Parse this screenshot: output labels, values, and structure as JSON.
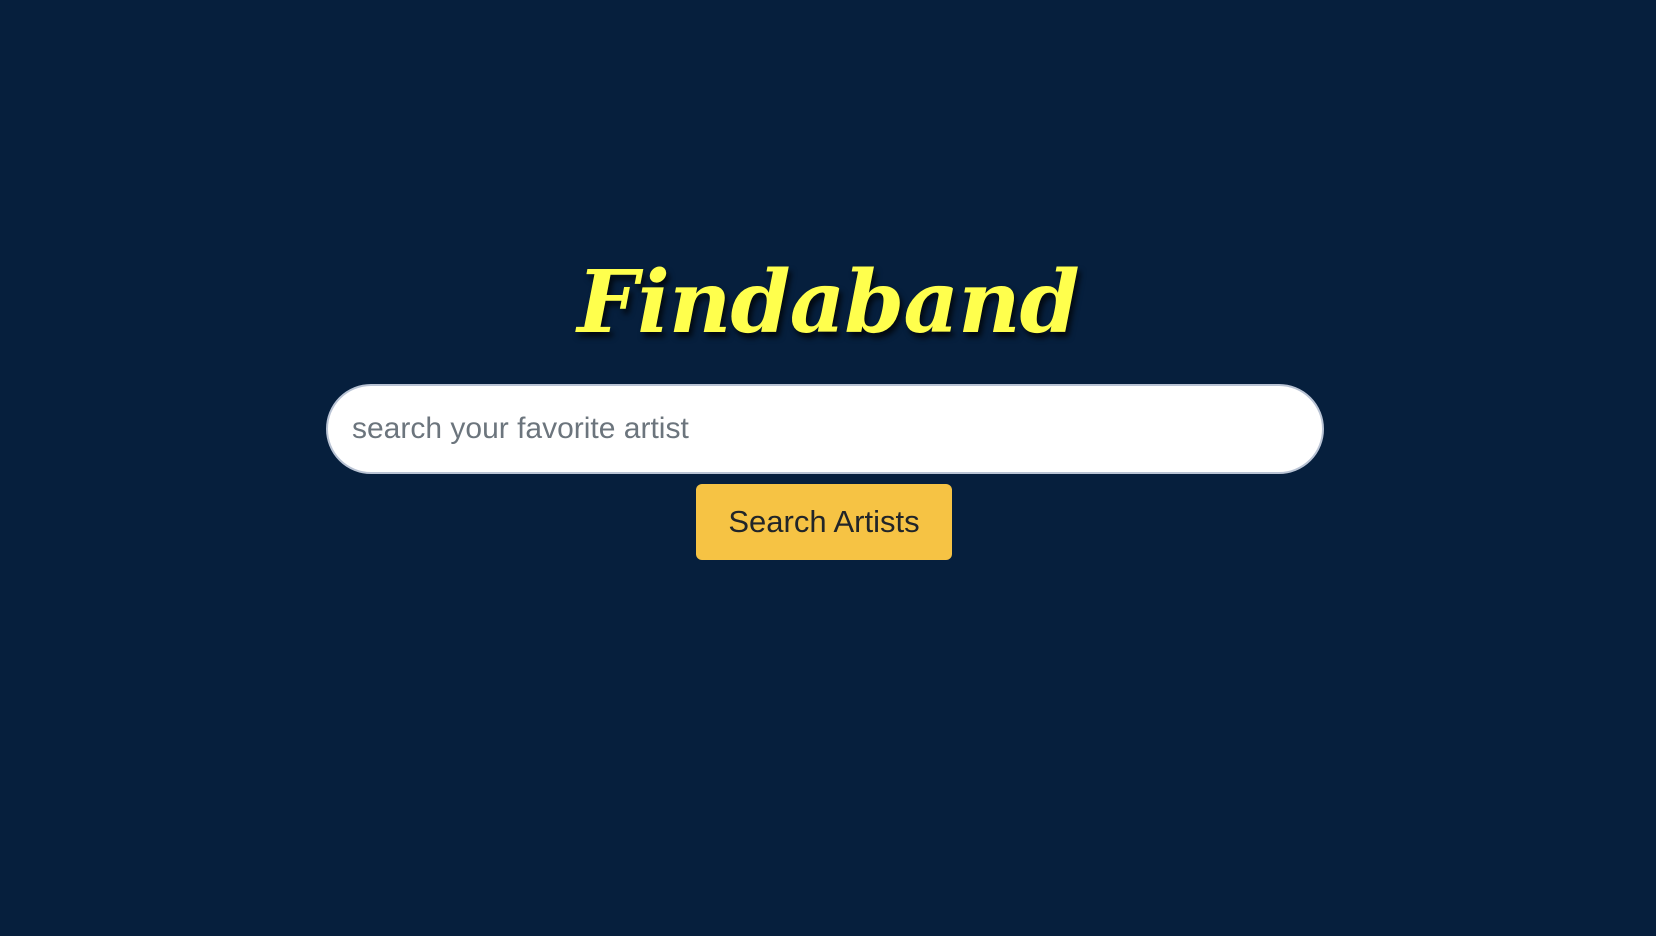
{
  "app": {
    "logo_text": "Findaband"
  },
  "search": {
    "placeholder": "search your favorite artist",
    "value": "",
    "button_label": "Search Artists"
  },
  "colors": {
    "background": "#061f3d",
    "logo": "#ffff4d",
    "button": "#f6c344",
    "input_background": "#ffffff",
    "placeholder_text": "#6c757d"
  }
}
